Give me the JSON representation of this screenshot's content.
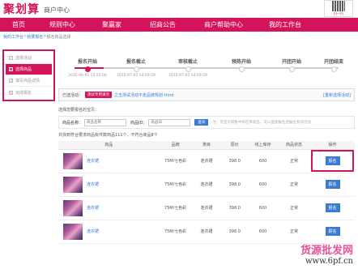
{
  "header": {
    "logo": "聚划算",
    "subtitle": "商户中心",
    "qr_text": "扫一扫"
  },
  "nav": [
    "首页",
    "规则中心",
    "聚赢家",
    "招商公告",
    "商户帮助中心",
    "我的工作台"
  ],
  "breadcrumb": {
    "home": "我的工作台",
    "sep1": " > ",
    "mid": "我要报名",
    "sep2": " > ",
    "current": "报名商品选择"
  },
  "sidebar": [
    {
      "label": "选择活动",
      "active": false
    },
    {
      "label": "选择商品",
      "active": true
    },
    {
      "label": "填写商品详情",
      "active": false
    },
    {
      "label": "完成报名",
      "active": false
    }
  ],
  "steps": [
    {
      "label": "报名开始",
      "date": "2015-06-05 15:55:00",
      "done": true
    },
    {
      "label": "报名截止",
      "date": "2015-07-05 14:59:59",
      "done": false
    },
    {
      "label": "审核截止",
      "date": "2015-07-05 14:59:59",
      "done": false
    },
    {
      "label": "预热开始",
      "date": "",
      "done": false
    },
    {
      "label": "开团开始",
      "date": "",
      "done": false
    },
    {
      "label": "开团结束",
      "date": "",
      "done": false
    }
  ],
  "selected": {
    "prefix": "已选活动：",
    "badge": "测试专用请勿",
    "name": "之玉测试活动不走品牌规划-third",
    "reselect": "[重新选择活动]"
  },
  "hint": "选择您要报名的宝贝：",
  "search": {
    "name_label": "商品名称：",
    "name_placeholder": "商品名称",
    "id_label": "商品ID：",
    "id_placeholder": "商品ID",
    "button": "查询",
    "note": "注：仅显示销售中和在库商品，可以直接报名后报名参加活动"
  },
  "count": "共找到符合要求商品有件数商品111个，不符合商品8个",
  "table": {
    "headers": [
      "商品",
      "品牌",
      "类目",
      "原价",
      "线上库存",
      "商品状态",
      "操作"
    ],
    "rows": [
      {
        "name": "连衣裙",
        "brand": "75M/七色彩",
        "category": "连衣裙",
        "price": "398.0",
        "stock": "600",
        "status": "正常",
        "action": "报名"
      },
      {
        "name": "连衣裙",
        "brand": "75M/七色彩",
        "category": "连衣裙",
        "price": "398.0",
        "stock": "600",
        "status": "正常",
        "action": "报名"
      },
      {
        "name": "连衣裙",
        "brand": "75M/七色彩",
        "category": "连衣裙",
        "price": "398.0",
        "stock": "600",
        "status": "正常",
        "action": "报名"
      },
      {
        "name": "连衣裙",
        "brand": "75M/七色彩",
        "category": "连衣裙",
        "price": "398.0",
        "stock": "600",
        "status": "正常",
        "action": "报名"
      }
    ]
  },
  "watermark": {
    "top": "货源批发网",
    "bottom": "www.6pf.cn"
  }
}
